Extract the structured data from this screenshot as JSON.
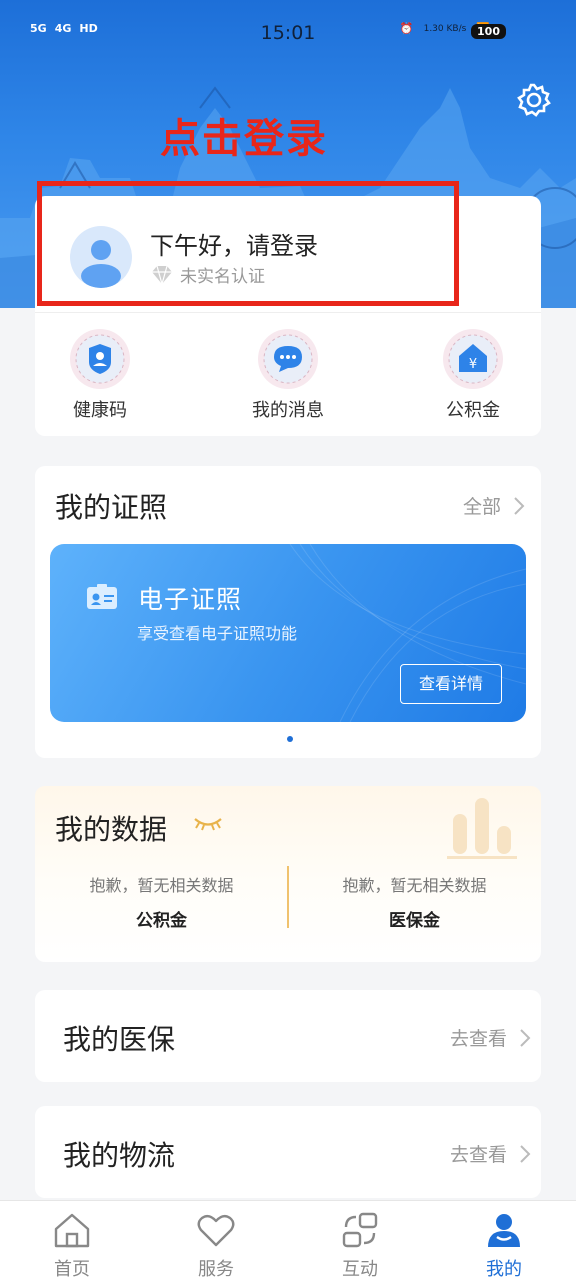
{
  "status_bar": {
    "network_left": [
      "5G",
      "4G",
      "HD"
    ],
    "time": "15:01",
    "speed": "1.30 KB/s",
    "battery": "100"
  },
  "annotation": {
    "login_hint": "点击登录"
  },
  "profile": {
    "greeting": "下午好，请登录",
    "realname_status": "未实名认证"
  },
  "quick_actions": [
    {
      "label": "健康码",
      "icon": "health-code-icon"
    },
    {
      "label": "我的消息",
      "icon": "message-icon"
    },
    {
      "label": "公积金",
      "icon": "fund-icon"
    }
  ],
  "licenses": {
    "title": "我的证照",
    "more": "全部",
    "banner_title": "电子证照",
    "banner_sub": "享受查看电子证照功能",
    "banner_button": "查看详情"
  },
  "my_data": {
    "title": "我的数据",
    "cols": [
      {
        "msg": "抱歉，暂无相关数据",
        "name": "公积金"
      },
      {
        "msg": "抱歉，暂无相关数据",
        "name": "医保金"
      }
    ]
  },
  "medical": {
    "title": "我的医保",
    "more": "去查看"
  },
  "logistics": {
    "title": "我的物流",
    "more": "去查看"
  },
  "tabs": [
    {
      "label": "首页",
      "icon": "home-icon"
    },
    {
      "label": "服务",
      "icon": "heart-icon"
    },
    {
      "label": "互动",
      "icon": "interact-icon"
    },
    {
      "label": "我的",
      "icon": "user-icon"
    }
  ],
  "colors": {
    "accent": "#1f6fd6",
    "annotation": "#e8261a"
  }
}
